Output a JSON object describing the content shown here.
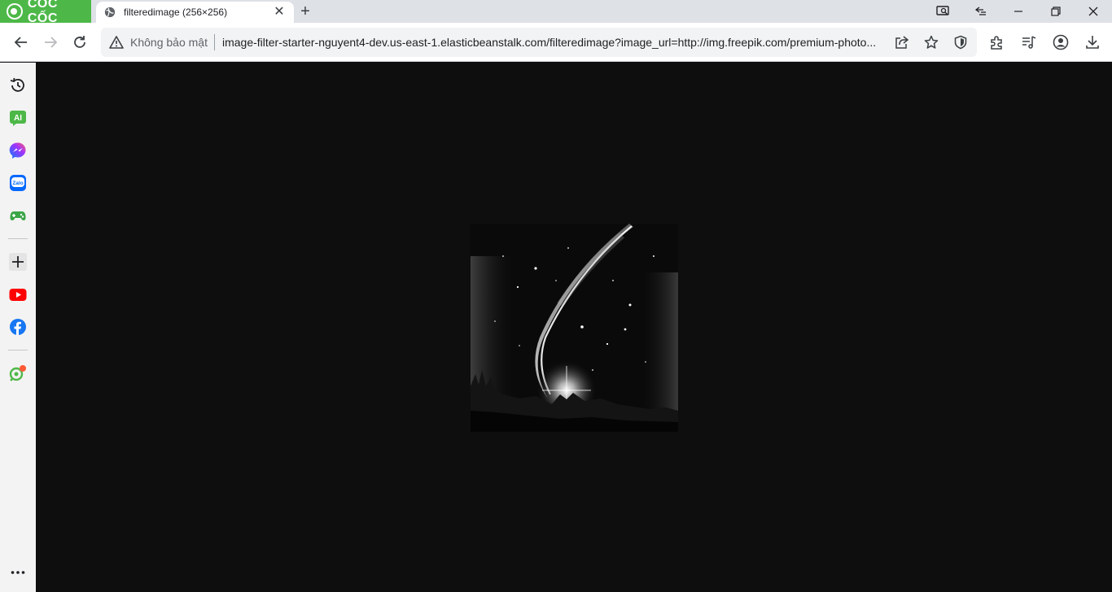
{
  "browser": {
    "brand_name": "CỐC CỐC",
    "tab": {
      "title": "filteredimage (256×256)"
    },
    "address_bar": {
      "security_label": "Không bảo mật",
      "url": "image-filter-starter-nguyent4-dev.us-east-1.elasticbeanstalk.com/filteredimage?image_url=http://img.freepik.com/premium-photo..."
    },
    "colors": {
      "brand": "#4db848",
      "tab_strip": "#dee1e6",
      "sidebar": "#f3f3f3",
      "page_background": "#0e0e0e"
    }
  },
  "sidebar": {
    "items": [
      {
        "name": "history-icon"
      },
      {
        "name": "ai-assistant-icon",
        "label": "AI"
      },
      {
        "name": "messenger-icon"
      },
      {
        "name": "zalo-icon",
        "label": "Zalo"
      },
      {
        "name": "games-icon"
      },
      {
        "name": "add-icon"
      },
      {
        "name": "youtube-icon"
      },
      {
        "name": "facebook-icon"
      },
      {
        "name": "extension-pin-icon"
      },
      {
        "name": "more-icon"
      }
    ]
  },
  "content": {
    "image": {
      "description_icon": "filtered-grayscale-image",
      "size_label": "256×256"
    }
  }
}
